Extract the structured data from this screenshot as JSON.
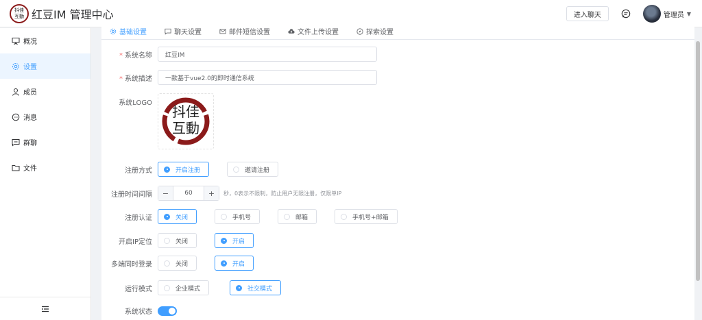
{
  "header": {
    "logo_chars": [
      "抖",
      "佳",
      "互",
      "動"
    ],
    "title": "红豆IM 管理中心",
    "enter_chat_label": "进入聊天",
    "user_name": "管理员"
  },
  "sidebar": {
    "items": [
      {
        "label": "概况",
        "icon": "presentation-icon"
      },
      {
        "label": "设置",
        "icon": "gear-icon",
        "active": true
      },
      {
        "label": "成员",
        "icon": "user-icon"
      },
      {
        "label": "消息",
        "icon": "chat-bubble-icon"
      },
      {
        "label": "群聊",
        "icon": "message-square-icon"
      },
      {
        "label": "文件",
        "icon": "folder-icon"
      }
    ],
    "collapse_icon": "menu-fold-icon"
  },
  "tabs": [
    {
      "label": "基础设置",
      "icon": "gear-icon",
      "active": true
    },
    {
      "label": "聊天设置",
      "icon": "chat-icon"
    },
    {
      "label": "邮件短信设置",
      "icon": "mail-icon"
    },
    {
      "label": "文件上传设置",
      "icon": "cloud-upload-icon"
    },
    {
      "label": "探索设置",
      "icon": "compass-icon"
    }
  ],
  "form": {
    "system_name": {
      "label": "系统名称",
      "value": "红豆IM"
    },
    "system_desc": {
      "label": "系统描述",
      "value": "一款基于vue2.0的即时通信系统"
    },
    "system_logo": {
      "label": "系统LOGO",
      "logo_chars": [
        "抖",
        "佳",
        "互",
        "動"
      ]
    },
    "register_mode": {
      "label": "注册方式",
      "options": [
        "开启注册",
        "邀请注册"
      ],
      "selected": 0
    },
    "register_interval": {
      "label": "注册时间间隔",
      "value": "60",
      "minus": "−",
      "plus": "+",
      "hint": "秒，0表示不限制，防止用户无限注册，仅限单IP"
    },
    "register_auth": {
      "label": "注册认证",
      "options": [
        "关闭",
        "手机号",
        "邮箱",
        "手机号+邮箱"
      ],
      "selected": 0
    },
    "ip_location": {
      "label": "开启IP定位",
      "options": [
        "关闭",
        "开启"
      ],
      "selected": 1
    },
    "multi_login": {
      "label": "多端同时登录",
      "options": [
        "关闭",
        "开启"
      ],
      "selected": 1
    },
    "run_mode": {
      "label": "运行模式",
      "options": [
        "企业模式",
        "社交模式"
      ],
      "selected": 1
    },
    "system_status": {
      "label": "系统状态",
      "on": true
    }
  },
  "colors": {
    "primary": "#409eff",
    "required": "#f56c6c",
    "logo_red": "#8b1a1a"
  }
}
